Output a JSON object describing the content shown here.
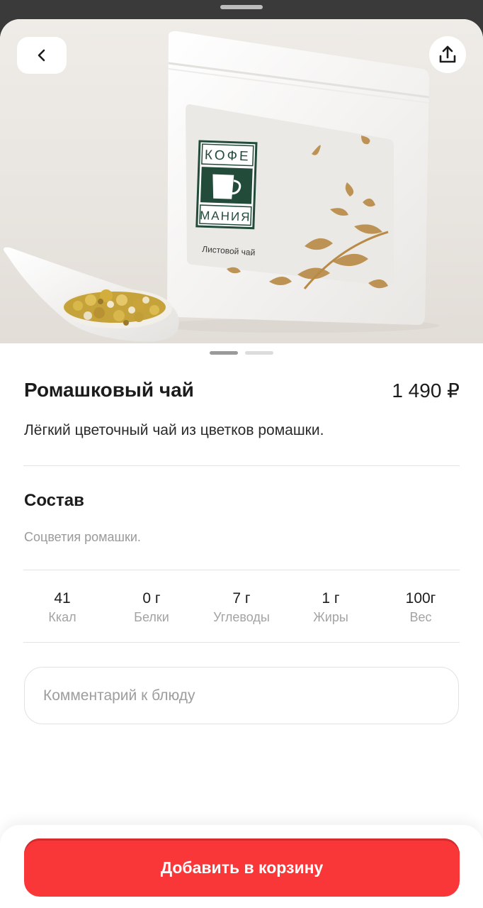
{
  "product": {
    "title": "Ромашковый чай",
    "price": "1 490 ₽",
    "description": "Лёгкий цветочный чай из цветков ромашки.",
    "image_slides": {
      "count": 2,
      "active_index": 0
    },
    "package_label": {
      "brand_line1": "КОФЕ",
      "brand_line2": "МАНИЯ",
      "subtitle": "Листовой чай"
    }
  },
  "composition": {
    "heading": "Состав",
    "text": "Соцветия ромашки."
  },
  "nutrition": [
    {
      "value": "41",
      "label": "Ккал"
    },
    {
      "value": "0 г",
      "label": "Белки"
    },
    {
      "value": "7 г",
      "label": "Углеводы"
    },
    {
      "value": "1 г",
      "label": "Жиры"
    },
    {
      "value": "100г",
      "label": "Вес"
    }
  ],
  "comment": {
    "placeholder": "Комментарий к блюду"
  },
  "cta": {
    "label": "Добавить в корзину"
  },
  "icons": {
    "back": "chevron-left-icon",
    "share": "share-upload-icon"
  },
  "colors": {
    "accent": "#f93738",
    "muted_text": "#9a9a9a"
  }
}
